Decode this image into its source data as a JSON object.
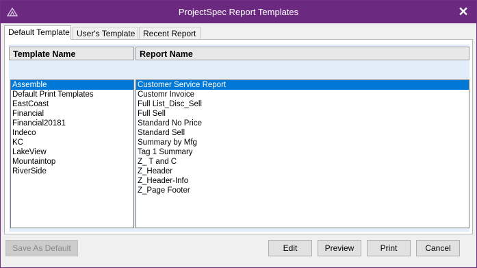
{
  "window": {
    "title": "ProjectSpec Report Templates"
  },
  "tabs": [
    {
      "label": "Default Template",
      "active": true
    },
    {
      "label": "User's Template",
      "active": false
    },
    {
      "label": "Recent Report",
      "active": false
    }
  ],
  "columns": {
    "template_name": "Template Name",
    "report_name": "Report Name"
  },
  "templates": [
    "Assemble",
    "Default Print Templates",
    "EastCoast",
    "Financial",
    "Financial20181",
    "Indeco",
    "KC",
    "LakeView",
    "Mountaintop",
    "RiverSide"
  ],
  "reports": [
    "Customer Service Report",
    "Customr Invoice",
    "Full List_Disc_Sell",
    "Full Sell",
    "Standard No Price",
    "Standard Sell",
    "Summary by Mfg",
    "Tag 1 Summary",
    "Z_ T and C",
    "Z_Header",
    "Z_Header-Info",
    "Z_Page Footer"
  ],
  "selected_template": "Assemble",
  "selected_report": "Customer Service Report",
  "buttons": {
    "save_default": "Save As Default",
    "edit": "Edit",
    "preview": "Preview",
    "print": "Print",
    "cancel": "Cancel"
  },
  "colors": {
    "titlebar": "#6b2a80",
    "selection": "#0078d7",
    "band": "#e3edf9"
  }
}
